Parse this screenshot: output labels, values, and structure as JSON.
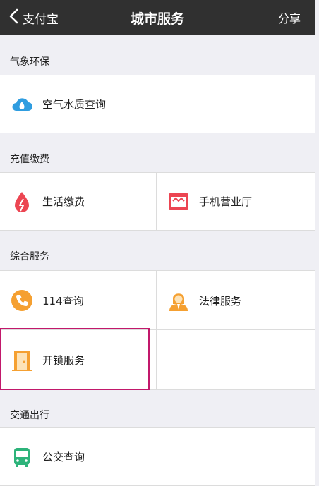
{
  "navbar": {
    "back_label": "支付宝",
    "title": "城市服务",
    "share_label": "分享"
  },
  "sections": [
    {
      "title": "气象环保",
      "items": [
        {
          "label": "空气水质查询",
          "icon": "cloud-water-icon",
          "color": "#2f9de0"
        }
      ]
    },
    {
      "title": "充值缴费",
      "items": [
        {
          "label": "生活缴费",
          "icon": "water-drop-icon",
          "color": "#ec4552"
        },
        {
          "label": "手机营业厅",
          "icon": "store-icon",
          "color": "#ec4552"
        }
      ]
    },
    {
      "title": "综合服务",
      "items": [
        {
          "label": "114查询",
          "icon": "phone-icon",
          "color": "#f5a031"
        },
        {
          "label": "法律服务",
          "icon": "lawyer-icon",
          "color": "#f5a031"
        },
        {
          "label": "开锁服务",
          "icon": "door-icon",
          "color": "#f5a031"
        }
      ]
    },
    {
      "title": "交通出行",
      "items": [
        {
          "label": "公交查询",
          "icon": "bus-icon",
          "color": "#2db37a"
        }
      ]
    }
  ],
  "colors": {
    "navbar_bg": "#303030",
    "page_bg": "#efeff4",
    "highlight_border": "#c2186b"
  }
}
